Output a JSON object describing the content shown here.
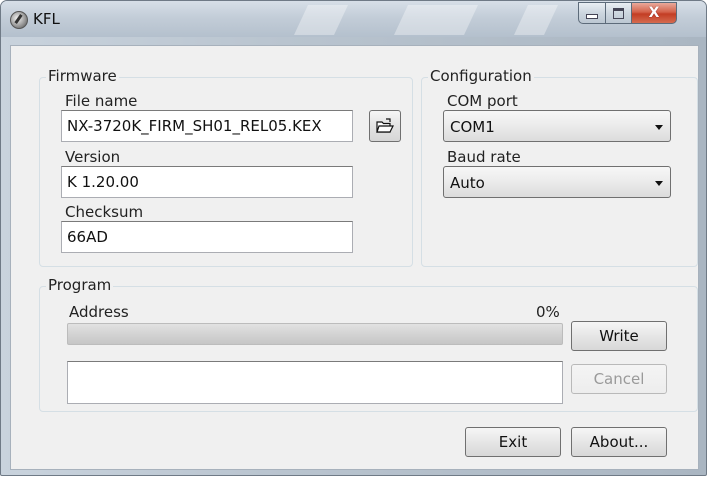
{
  "window": {
    "title": "KFL",
    "controls": {
      "minimize": "minimize-icon",
      "maximize": "maximize-icon",
      "close": "close-icon"
    }
  },
  "firmware": {
    "group_title": "Firmware",
    "file_name_label": "File name",
    "file_name_value": "NX-3720K_FIRM_SH01_REL05.KEX",
    "browse_icon": "open-folder-icon",
    "version_label": "Version",
    "version_value": "K 1.20.00",
    "checksum_label": "Checksum",
    "checksum_value": "66AD"
  },
  "configuration": {
    "group_title": "Configuration",
    "com_port_label": "COM port",
    "com_port_value": "COM1",
    "baud_rate_label": "Baud rate",
    "baud_rate_value": "Auto"
  },
  "program": {
    "group_title": "Program",
    "address_label": "Address",
    "progress_percent_text": "0%",
    "progress_fraction": 0,
    "write_label": "Write",
    "cancel_label": "Cancel",
    "log_text": ""
  },
  "footer": {
    "exit_label": "Exit",
    "about_label": "About..."
  }
}
